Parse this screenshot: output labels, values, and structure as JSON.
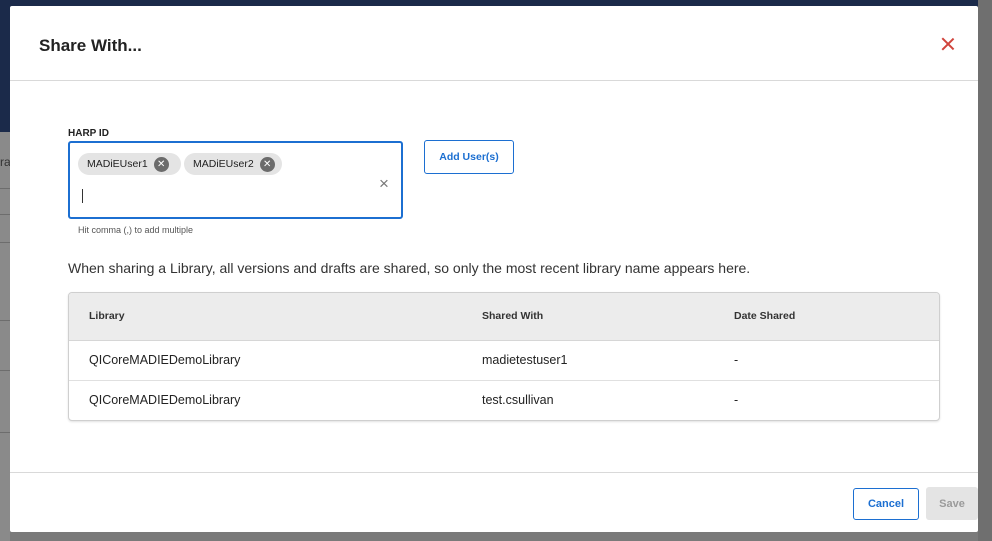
{
  "background": {
    "snippet": "ra"
  },
  "modal": {
    "title": "Share With...",
    "harp": {
      "label": "HARP ID",
      "chips": [
        "MADiEUser1",
        "MADiEUser2"
      ],
      "hint": "Hit comma (,) to add multiple"
    },
    "add_button": "Add User(s)",
    "info_text": "When sharing a Library, all versions and drafts are shared, so only the most recent library name appears here.",
    "table": {
      "headers": [
        "Library",
        "Shared With",
        "Date Shared"
      ],
      "rows": [
        [
          "QICoreMADIEDemoLibrary",
          "madietestuser1",
          "-"
        ],
        [
          "QICoreMADIEDemoLibrary",
          "test.csullivan",
          "-"
        ]
      ]
    },
    "footer": {
      "cancel": "Cancel",
      "save": "Save"
    }
  },
  "colors": {
    "accent": "#1c6fd1",
    "close": "#d0443c",
    "header_bg": "#ececec"
  },
  "icons": {
    "close": "close-icon",
    "chip_remove": "cancel-circle-icon",
    "clear": "clear-icon"
  }
}
